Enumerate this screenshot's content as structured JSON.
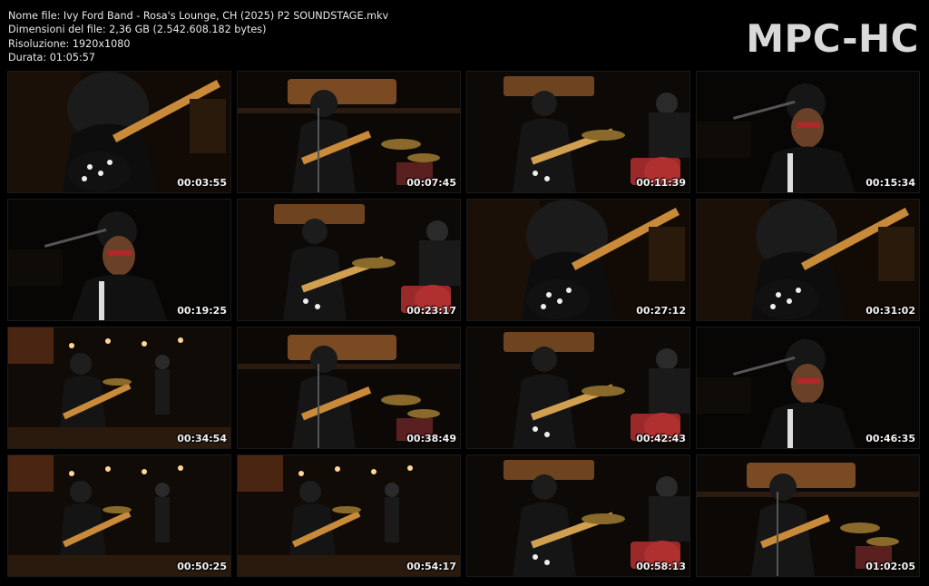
{
  "header": {
    "file_name": "Nome file: Ivy Ford Band - Rosa's Lounge, CH (2025) P2 SOUNDSTAGE.mkv",
    "file_size": "Dimensioni del file: 2,36 GB (2.542.608.182 bytes)",
    "resolution": "Risoluzione: 1920x1080",
    "duration": "Durata: 01:05:57"
  },
  "logo": "MPC-HC",
  "thumbnails": [
    {
      "time": "00:03:55",
      "scene": "guitar-close"
    },
    {
      "time": "00:07:45",
      "scene": "stage-wide"
    },
    {
      "time": "00:11:39",
      "scene": "stage-drummer"
    },
    {
      "time": "00:15:34",
      "scene": "face-close"
    },
    {
      "time": "00:19:25",
      "scene": "face-close"
    },
    {
      "time": "00:23:17",
      "scene": "stage-drummer"
    },
    {
      "time": "00:27:12",
      "scene": "guitar-close"
    },
    {
      "time": "00:31:02",
      "scene": "guitar-close"
    },
    {
      "time": "00:34:54",
      "scene": "lounge-wide"
    },
    {
      "time": "00:38:49",
      "scene": "stage-wide"
    },
    {
      "time": "00:42:43",
      "scene": "stage-drummer"
    },
    {
      "time": "00:46:35",
      "scene": "face-close"
    },
    {
      "time": "00:50:25",
      "scene": "lounge-wide"
    },
    {
      "time": "00:54:17",
      "scene": "lounge-wide"
    },
    {
      "time": "00:58:13",
      "scene": "stage-drummer"
    },
    {
      "time": "01:02:05",
      "scene": "stage-wide"
    }
  ]
}
